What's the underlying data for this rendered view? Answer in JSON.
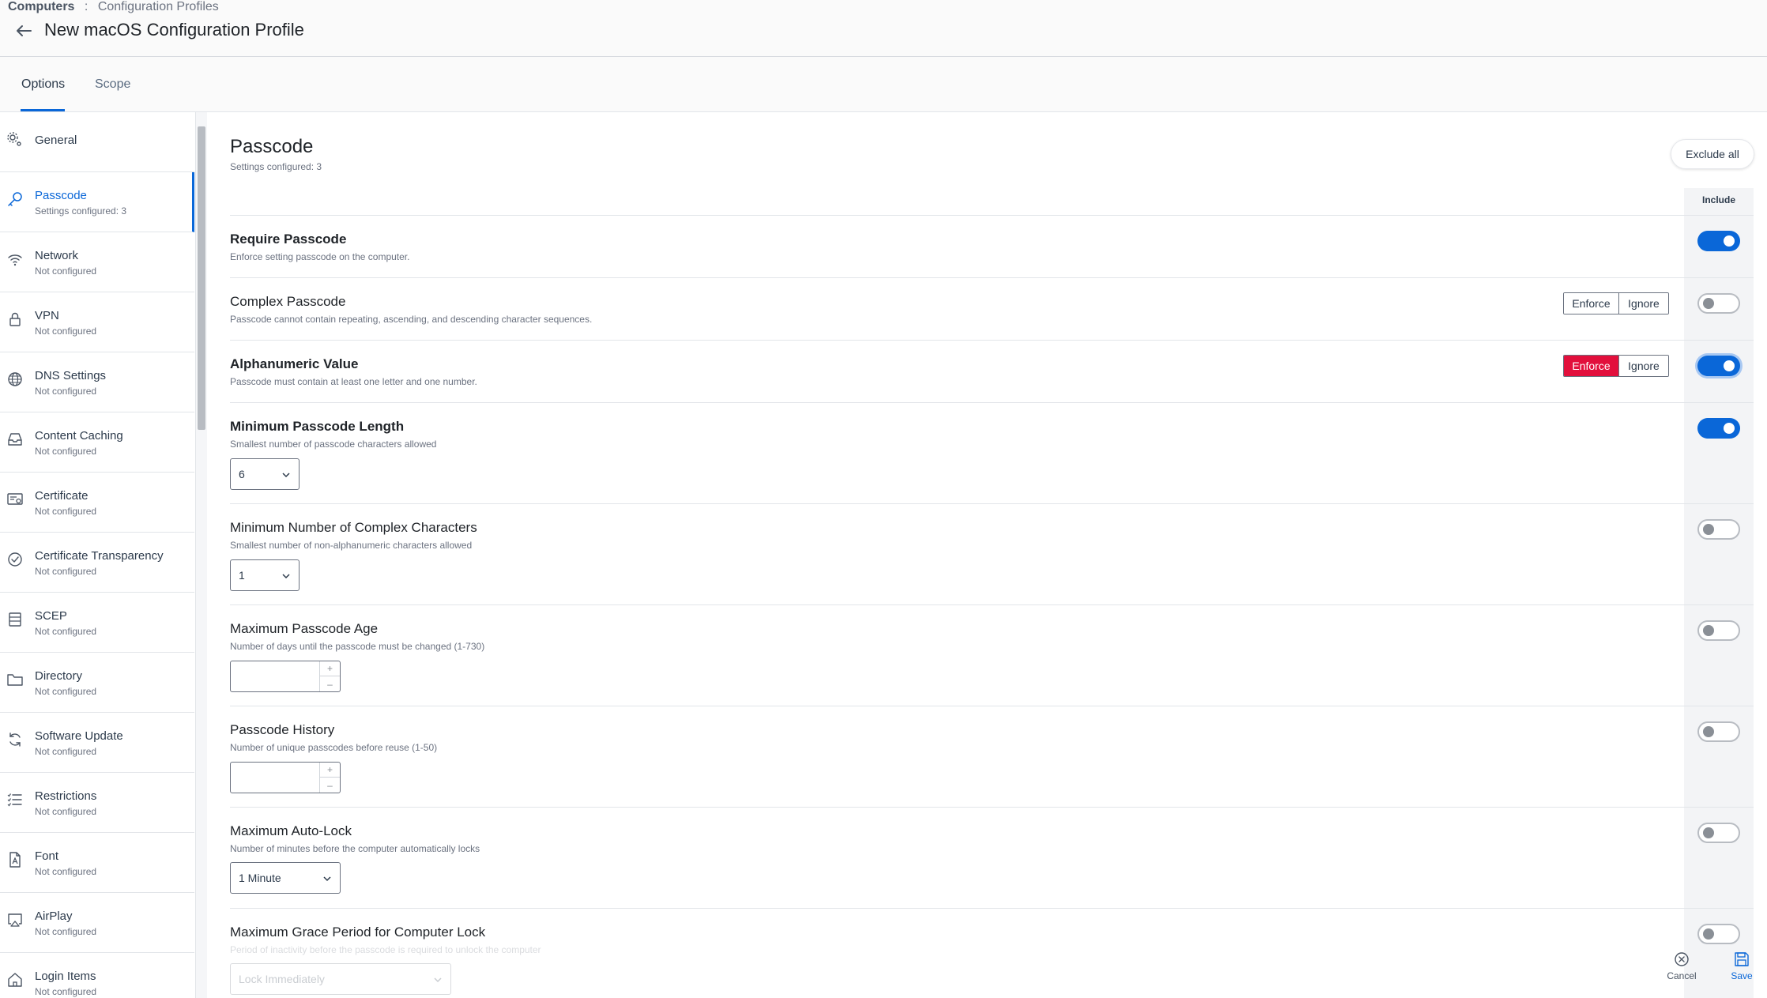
{
  "breadcrumb": {
    "root": "Computers",
    "separator": ":",
    "current": "Configuration Profiles"
  },
  "header": {
    "title": "New macOS Configuration Profile"
  },
  "tabs": [
    {
      "label": "Options"
    },
    {
      "label": "Scope"
    }
  ],
  "sidebar": {
    "items": [
      {
        "label": "General",
        "sub": "",
        "icon": "gear-icon"
      },
      {
        "label": "Passcode",
        "sub": "Settings configured: 3",
        "icon": "key-icon"
      },
      {
        "label": "Network",
        "sub": "Not configured",
        "icon": "wifi-icon"
      },
      {
        "label": "VPN",
        "sub": "Not configured",
        "icon": "lock-icon"
      },
      {
        "label": "DNS Settings",
        "sub": "Not configured",
        "icon": "globe-icon"
      },
      {
        "label": "Content Caching",
        "sub": "Not configured",
        "icon": "inbox-icon"
      },
      {
        "label": "Certificate",
        "sub": "Not configured",
        "icon": "certificate-icon"
      },
      {
        "label": "Certificate Transparency",
        "sub": "Not configured",
        "icon": "check-circle-icon"
      },
      {
        "label": "SCEP",
        "sub": "Not configured",
        "icon": "list-box-icon"
      },
      {
        "label": "Directory",
        "sub": "Not configured",
        "icon": "folder-icon"
      },
      {
        "label": "Software Update",
        "sub": "Not configured",
        "icon": "refresh-icon"
      },
      {
        "label": "Restrictions",
        "sub": "Not configured",
        "icon": "checklist-icon"
      },
      {
        "label": "Font",
        "sub": "Not configured",
        "icon": "font-file-icon"
      },
      {
        "label": "AirPlay",
        "sub": "Not configured",
        "icon": "airplay-icon"
      },
      {
        "label": "Login Items",
        "sub": "Not configured",
        "icon": "home-icon"
      }
    ]
  },
  "section": {
    "title": "Passcode",
    "subtitle": "Settings configured: 3",
    "exclude_all": "Exclude all",
    "include_header": "Include"
  },
  "settings": [
    {
      "title": "Require Passcode",
      "desc": "Enforce setting passcode on the computer.",
      "included": true
    },
    {
      "title": "Complex Passcode",
      "desc": "Passcode cannot contain repeating, ascending, and descending character sequences.",
      "included": false,
      "enforce": "Enforce",
      "ignore": "Ignore",
      "selected": "none"
    },
    {
      "title": "Alphanumeric Value",
      "desc": "Passcode must contain at least one letter and one number.",
      "included": true,
      "enforce": "Enforce",
      "ignore": "Ignore",
      "selected": "Enforce"
    },
    {
      "title": "Minimum Passcode Length",
      "desc": "Smallest number of passcode characters allowed",
      "included": true,
      "value": "6"
    },
    {
      "title": "Minimum Number of Complex Characters",
      "desc": "Smallest number of non-alphanumeric characters allowed",
      "included": false,
      "value": "1"
    },
    {
      "title": "Maximum Passcode Age",
      "desc": "Number of days until the passcode must be changed (1-730)",
      "included": false,
      "value": ""
    },
    {
      "title": "Passcode History",
      "desc": "Number of unique passcodes before reuse (1-50)",
      "included": false,
      "value": ""
    },
    {
      "title": "Maximum Auto-Lock",
      "desc": "Number of minutes before the computer automatically locks",
      "included": false,
      "value": "1 Minute"
    },
    {
      "title": "Maximum Grace Period for Computer Lock",
      "desc": "Period of inactivity before the passcode is required to unlock the computer",
      "included": false,
      "value": "Lock Immediately"
    }
  ],
  "stepper_symbols": {
    "plus": "+",
    "minus": "–"
  },
  "actions": {
    "cancel": "Cancel",
    "save": "Save"
  },
  "colors": {
    "accent": "#0a67d8",
    "enforce_active": "#e20f3c"
  }
}
